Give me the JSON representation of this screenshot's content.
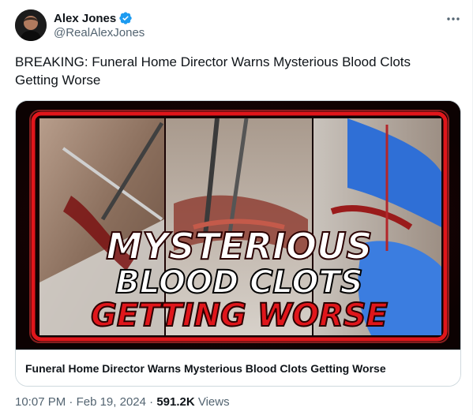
{
  "author": {
    "display_name": "Alex Jones",
    "handle": "@RealAlexJones",
    "verified_icon": "verified-badge-icon",
    "verified_color": "#1d9bf0"
  },
  "more_icon": "more-options-icon",
  "tweet": {
    "text": "BREAKING: Funeral Home Director Warns Mysterious Blood Clots Getting Worse"
  },
  "card": {
    "image_headline_line1": "MYSTERIOUS",
    "image_headline_line2": "BLOOD CLOTS",
    "image_headline_line3": "GETTING WORSE",
    "title": "Funeral Home Director Warns Mysterious Blood Clots Getting Worse",
    "accent_color": "#e0161b"
  },
  "meta": {
    "time": "10:07 PM",
    "separator": "·",
    "date": "Feb 19, 2024",
    "views_count": "591.2K",
    "views_label": "Views"
  },
  "colors": {
    "text_primary": "#0f1419",
    "text_secondary": "#536471",
    "border": "#cfd9de"
  }
}
